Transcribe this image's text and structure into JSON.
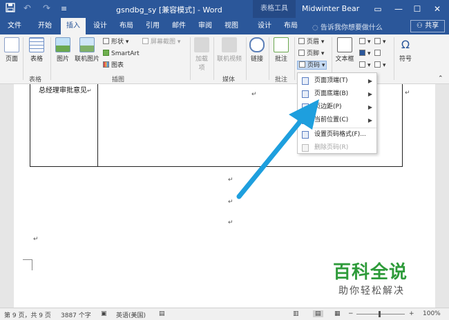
{
  "titlebar": {
    "doc_title": "gsndbg_sy [兼容模式] - Word",
    "context_tab": "表格工具",
    "user": "Midwinter Bear",
    "save_icon": "save-icon",
    "undo_glyph": "↶",
    "redo_glyph": "↷",
    "customize_glyph": "≡",
    "restore_glyph": "▭",
    "minimize_glyph": "—",
    "maximize_glyph": "☐",
    "close_glyph": "✕"
  },
  "tabs": [
    "文件",
    "开始",
    "插入",
    "设计",
    "布局",
    "引用",
    "邮件",
    "审阅",
    "视图",
    "设计",
    "布局"
  ],
  "active_tab_index": 2,
  "tellme": "告诉我你想要做什么",
  "share": "共享",
  "ribbon": {
    "pages": "页面",
    "table": "表格",
    "picture": "图片",
    "online_picture": "联机图片",
    "shapes": "形状",
    "smartart": "SmartArt",
    "chart": "图表",
    "screenshot": "屏幕截图",
    "addins": "加载项",
    "online_video": "联机视频",
    "link": "链接",
    "comment": "批注",
    "header": "页眉",
    "footer": "页脚",
    "page_number": "页码",
    "textbox": "文本框",
    "symbol": "符号",
    "groups": {
      "table": "表格",
      "illustrations": "插图",
      "media": "媒体",
      "comments": "批注"
    }
  },
  "menu": {
    "items": [
      {
        "label": "页面顶端(T)",
        "has_sub": true,
        "enabled": true
      },
      {
        "label": "页面底端(B)",
        "has_sub": true,
        "enabled": true
      },
      {
        "label": "页边距(P)",
        "has_sub": true,
        "enabled": true
      },
      {
        "label": "当前位置(C)",
        "has_sub": true,
        "enabled": true
      },
      {
        "label": "设置页码格式(F)...",
        "has_sub": false,
        "enabled": true
      },
      {
        "label": "删除页码(R)",
        "has_sub": false,
        "enabled": false
      }
    ]
  },
  "document": {
    "cell_text": "总经理审批意见",
    "paragraph_mark": "↵"
  },
  "status": {
    "page": "第 9 页，共 9 页",
    "words": "3887 个字",
    "language": "英语(美国)",
    "zoom": "100%"
  },
  "watermark": {
    "title": "百科全说",
    "subtitle": "助你轻松解决"
  },
  "colors": {
    "accent": "#2b579a",
    "arrow": "#1e9fde",
    "watermark_green": "#2e9b3a"
  }
}
